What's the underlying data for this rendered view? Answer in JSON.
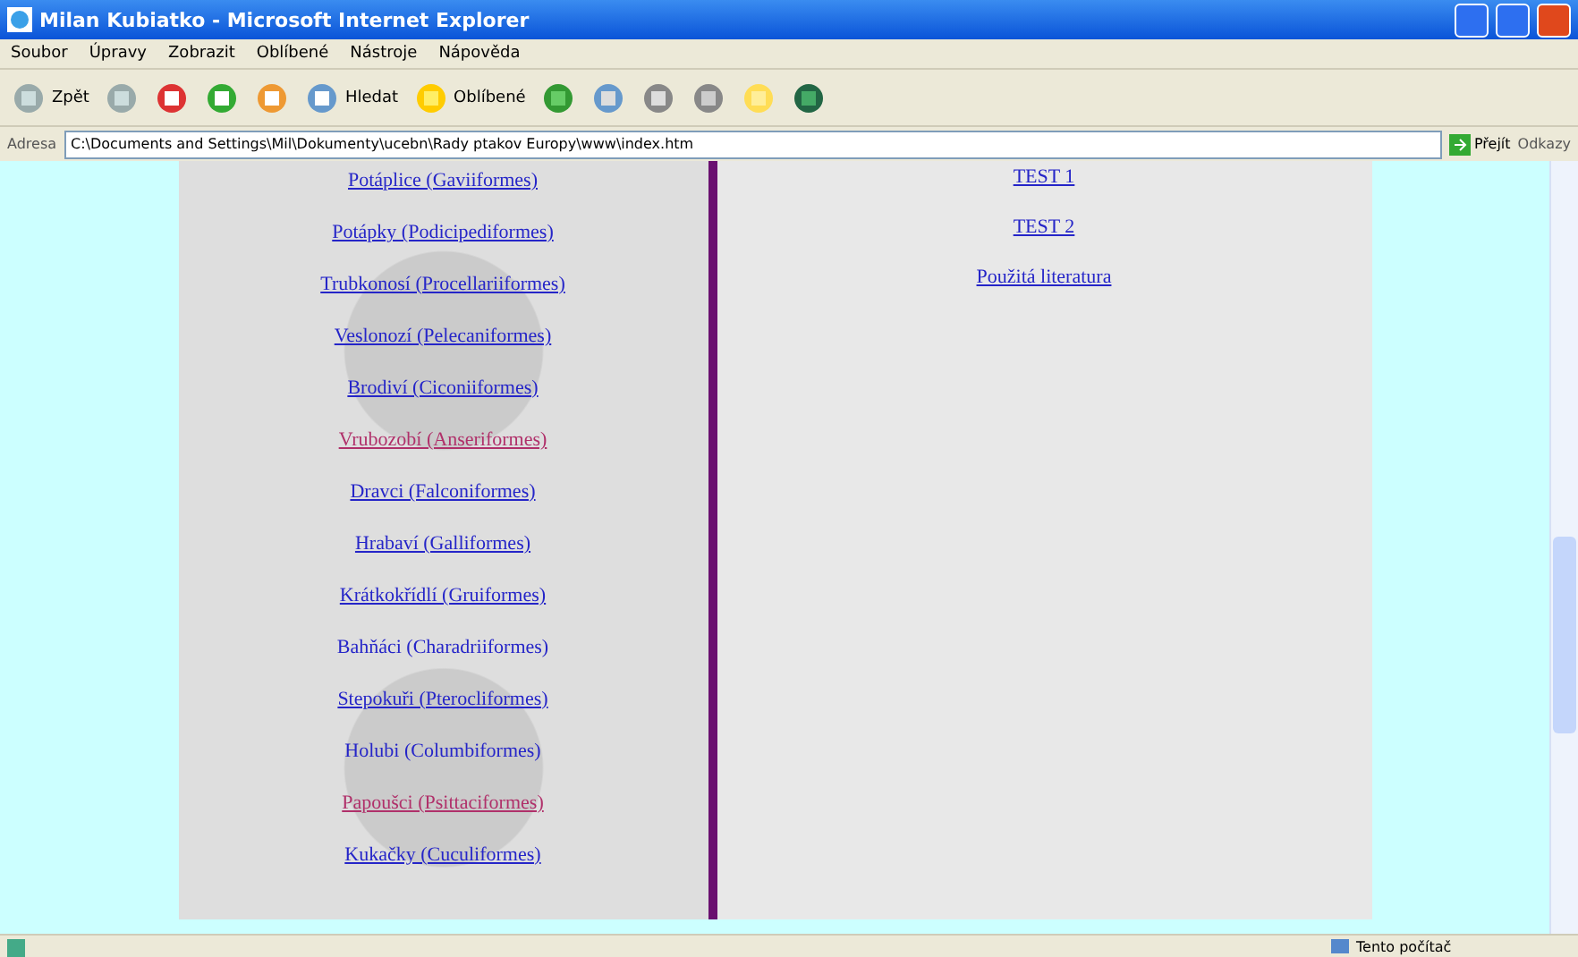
{
  "window": {
    "title": "Milan Kubiatko - Microsoft Internet Explorer"
  },
  "menu": [
    "Soubor",
    "Úpravy",
    "Zobrazit",
    "Oblíbené",
    "Nástroje",
    "Nápověda"
  ],
  "toolbar": {
    "back": "Zpět",
    "search": "Hledat",
    "favorites": "Oblíbené"
  },
  "address_bar": {
    "label": "Adresa",
    "value": "C:\\Documents and Settings\\Mil\\Dokumenty\\ucebn\\Rady ptakov Europy\\www\\index.htm",
    "go": "Přejít",
    "links": "Odkazy"
  },
  "left_links": [
    {
      "text": "Potáplice (Gaviiformes)",
      "kind": "link"
    },
    {
      "text": "Potápky (Podicipediformes)",
      "kind": "link"
    },
    {
      "text": "Trubkonosí (Procellariiformes)",
      "kind": "link"
    },
    {
      "text": "Veslonozí (Pelecaniformes)",
      "kind": "link"
    },
    {
      "text": "Brodiví (Ciconiiformes)",
      "kind": "link"
    },
    {
      "text": "Vrubozobí (Anseriformes)",
      "kind": "visited"
    },
    {
      "text": "Dravci (Falconiformes)",
      "kind": "link"
    },
    {
      "text": "Hrabaví (Galliformes)",
      "kind": "link"
    },
    {
      "text": "Krátkokřídlí (Gruiformes)",
      "kind": "link"
    },
    {
      "text": "Bahňáci (Charadriiformes)",
      "kind": "text"
    },
    {
      "text": "Stepokuři (Pterocliformes)",
      "kind": "link"
    },
    {
      "text": "Holubi (Columbiformes)",
      "kind": "text"
    },
    {
      "text": "Papoušci (Psittaciformes)",
      "kind": "visited"
    },
    {
      "text": "Kukačky (Cuculiformes)",
      "kind": "link"
    }
  ],
  "right_links": [
    {
      "text": "TEST 1",
      "kind": "link"
    },
    {
      "text": "TEST 2",
      "kind": "link"
    },
    {
      "text": "Použitá literatura",
      "kind": "link"
    }
  ],
  "status_bar": {
    "zone": "Tento počítač"
  }
}
